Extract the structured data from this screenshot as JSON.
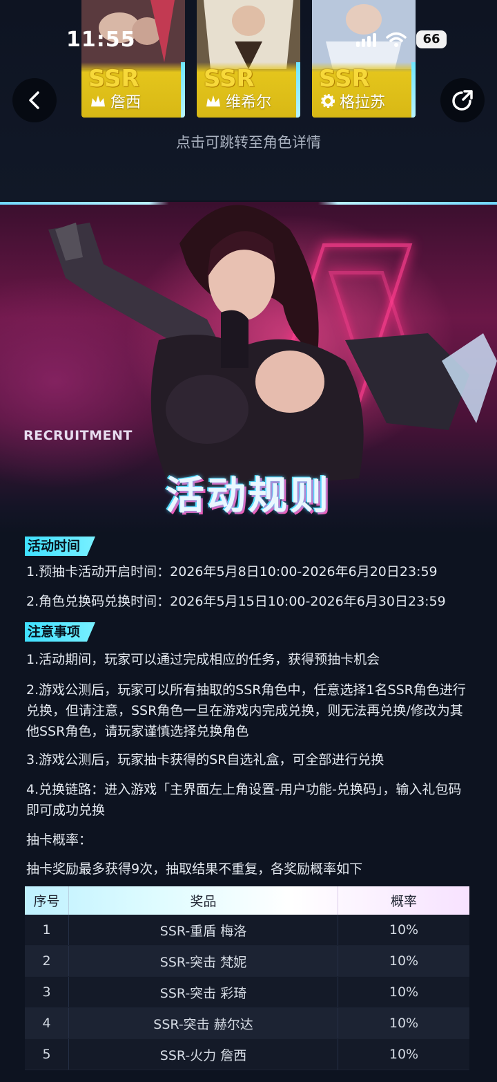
{
  "status": {
    "time": "11:55",
    "battery": "66"
  },
  "cards": [
    {
      "rarity": "SSR",
      "name": "詹西"
    },
    {
      "rarity": "SSR",
      "name": "维希尔"
    },
    {
      "rarity": "SSR",
      "name": "格拉苏"
    }
  ],
  "hint": "点击可跳转至角色详情",
  "banner": {
    "recruitment": "RECRUITMENT",
    "title": "活动规则"
  },
  "sections": {
    "time_tag": "活动时间",
    "time_lines": [
      "1.预抽卡活动开启时间：2026年5月8日10:00-2026年6月20日23:59",
      "2.角色兑换码兑换时间：2026年5月15日10:00-2026年6月30日23:59"
    ],
    "notes_tag": "注意事项",
    "note_lines": [
      "1.活动期间，玩家可以通过完成相应的任务，获得预抽卡机会",
      "2.游戏公测后，玩家可以所有抽取的SSR角色中，任意选择1名SSR角色进行兑换，但请注意，SSR角色一旦在游戏内完成兑换，则无法再兑换/修改为其他SSR角色，请玩家谨慎选择兑换角色",
      "3.游戏公测后，玩家抽卡获得的SR自选礼盒，可全部进行兑换",
      "4.兑换链路：进入游戏「主界面左上角设置-用户功能-兑换码」，输入礼包码即可成功兑换"
    ],
    "prob_label": "抽卡概率：",
    "prob_desc": "抽卡奖励最多获得9次，抽取结果不重复，各奖励概率如下"
  },
  "table": {
    "headers": [
      "序号",
      "奖品",
      "概率"
    ],
    "rows": [
      [
        "1",
        "SSR-重盾 梅洛",
        "10%"
      ],
      [
        "2",
        "SSR-突击 梵妮",
        "10%"
      ],
      [
        "3",
        "SSR-突击 彩琦",
        "10%"
      ],
      [
        "4",
        "SSR-突击 赫尔达",
        "10%"
      ],
      [
        "5",
        "SSR-火力 詹西",
        "10%"
      ]
    ]
  },
  "colors": {
    "accent_cyan": "#3fe0ff",
    "ssr_gold": "#e4c51c",
    "neon_pink": "#ff3d8e"
  },
  "icons": [
    "back-arrow-icon",
    "share-icon",
    "signal-icon",
    "wifi-icon",
    "battery-icon"
  ]
}
